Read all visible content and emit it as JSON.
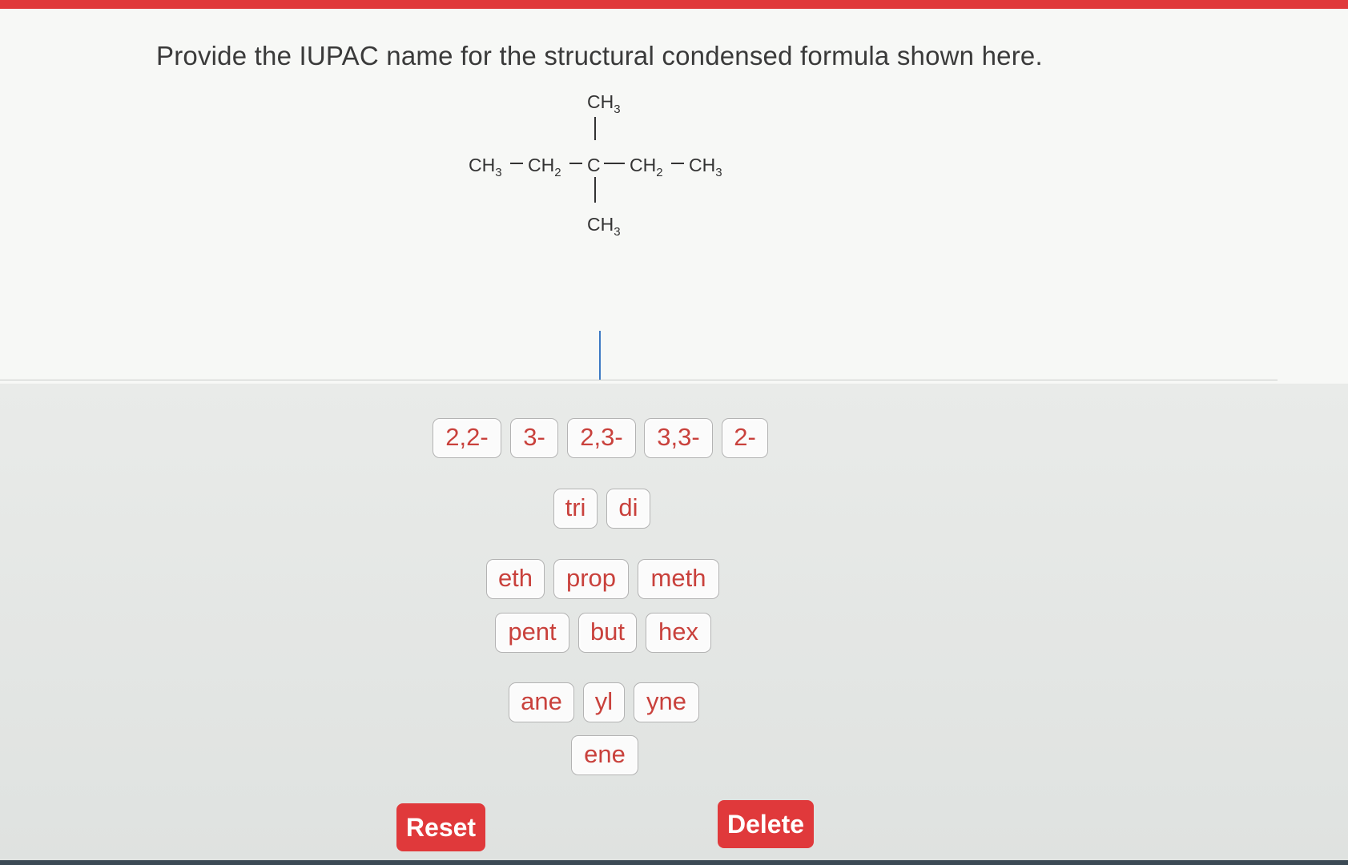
{
  "question": {
    "prompt": "Provide the IUPAC name for the structural condensed formula shown here."
  },
  "structure": {
    "top_sub": "CH",
    "top_sub_n": "3",
    "bottom_sub": "CH",
    "bottom_sub_n": "3",
    "chain": [
      {
        "label": "CH",
        "n": "3"
      },
      {
        "label": "CH",
        "n": "2"
      },
      {
        "label": "C",
        "n": ""
      },
      {
        "label": "CH",
        "n": "2"
      },
      {
        "label": "CH",
        "n": "3"
      }
    ]
  },
  "locants": [
    "2,2-",
    "3-",
    "2,3-",
    "3,3-",
    "2-"
  ],
  "multipliers": [
    "tri",
    "di"
  ],
  "stems_row1": [
    "eth",
    "prop",
    "meth"
  ],
  "stems_row2": [
    "pent",
    "but",
    "hex"
  ],
  "suffixes_row1": [
    "ane",
    "yl",
    "yne"
  ],
  "suffixes_row2": [
    "ene"
  ],
  "actions": {
    "reset": "Reset",
    "delete": "Delete"
  }
}
